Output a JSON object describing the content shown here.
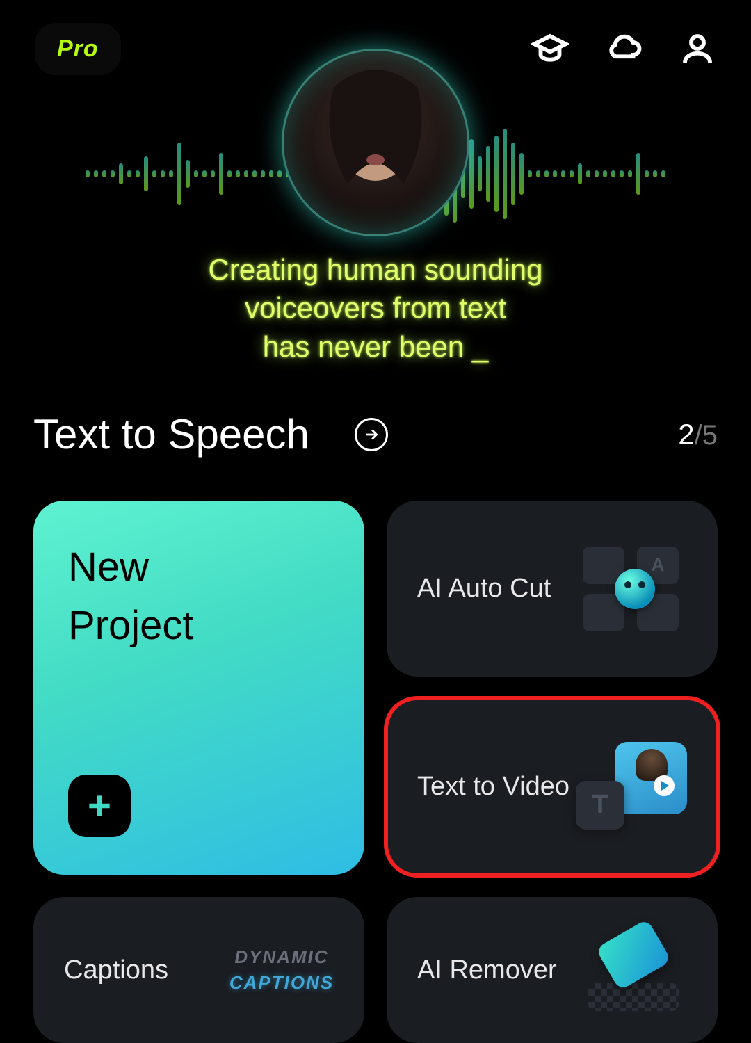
{
  "header": {
    "pro_label": "Pro",
    "icons": {
      "learn": "graduation-cap",
      "cloud": "cloud",
      "profile": "user"
    }
  },
  "hero": {
    "tagline_line1": "Creating human sounding",
    "tagline_line2": "voiceovers from text",
    "tagline_line3": "has never been _"
  },
  "title_row": {
    "title": "Text to Speech",
    "pager_current": "2",
    "pager_total": "5",
    "pager_sep": "/"
  },
  "cards": {
    "new_project": {
      "label": "New\nProject"
    },
    "ai_auto_cut": {
      "label": "AI Auto Cut"
    },
    "text_to_video": {
      "label": "Text to Video"
    },
    "captions": {
      "label": "Captions",
      "graphic_line1": "DYNAMIC",
      "graphic_line2": "CAPTIONS"
    },
    "ai_remover": {
      "label": "AI Remover"
    }
  },
  "colors": {
    "accent_lime": "#b6fc12",
    "accent_teal": "#3fd9c4",
    "card_bg": "#1a1d22",
    "highlight": "#f02020"
  }
}
